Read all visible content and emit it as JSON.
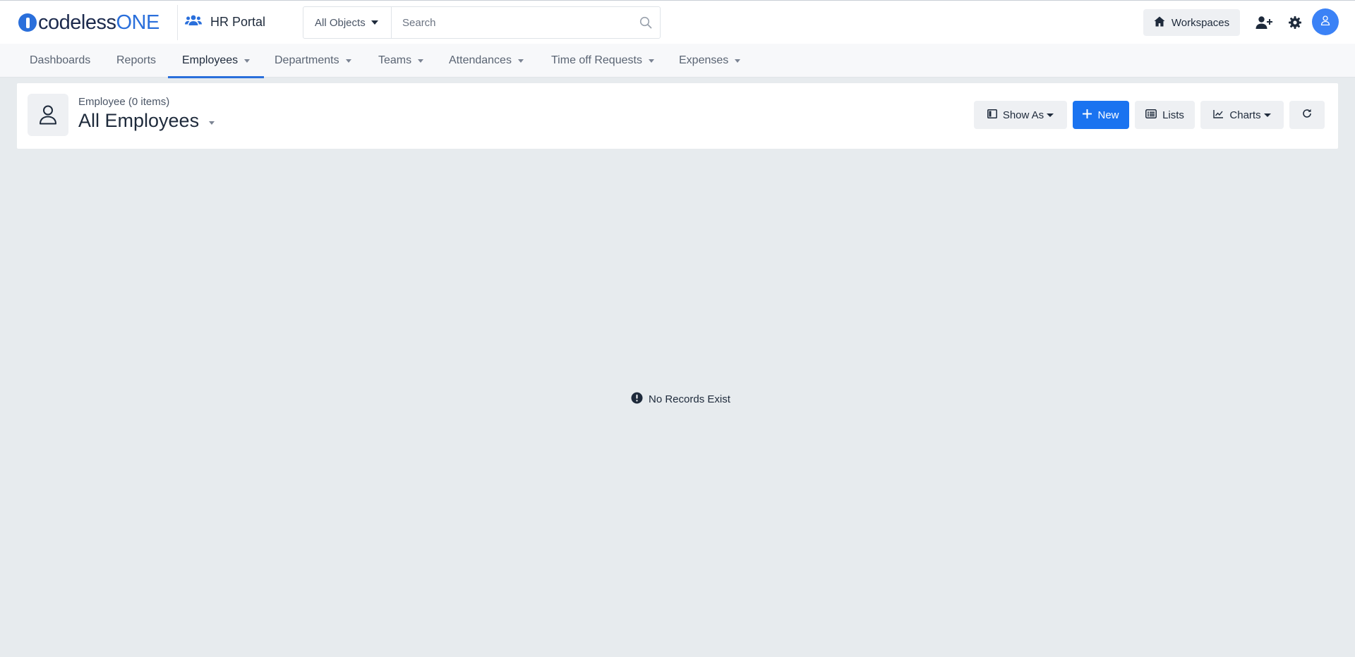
{
  "brand": {
    "logo_main": "codeless",
    "logo_accent": "ONE"
  },
  "app": {
    "name": "HR Portal"
  },
  "search": {
    "scope": "All Objects",
    "placeholder": "Search"
  },
  "header": {
    "workspaces_label": "Workspaces"
  },
  "nav": {
    "tabs": [
      {
        "label": "Dashboards",
        "has_dropdown": false,
        "active": false
      },
      {
        "label": "Reports",
        "has_dropdown": false,
        "active": false
      },
      {
        "label": "Employees",
        "has_dropdown": true,
        "active": true
      },
      {
        "label": "Departments",
        "has_dropdown": true,
        "active": false
      },
      {
        "label": "Teams",
        "has_dropdown": true,
        "active": false
      },
      {
        "label": "Attendances",
        "has_dropdown": true,
        "active": false
      },
      {
        "label": "Time off Requests",
        "has_dropdown": true,
        "active": false
      },
      {
        "label": "Expenses",
        "has_dropdown": true,
        "active": false
      }
    ]
  },
  "view": {
    "subtitle": "Employee (0 items)",
    "title": "All Employees",
    "actions": {
      "show_as": "Show As",
      "new": "New",
      "lists": "Lists",
      "charts": "Charts"
    }
  },
  "empty_state": {
    "message": "No Records Exist"
  },
  "icons": {
    "app": "users-icon",
    "search": "search-icon",
    "workspaces": "home-icon",
    "add_user": "user-plus-icon",
    "settings": "gear-icon",
    "avatar": "user-icon",
    "entity": "user-outline-icon",
    "show_as": "layout-icon",
    "new": "plus-icon",
    "lists": "list-icon",
    "charts": "chart-icon",
    "refresh": "refresh-icon",
    "empty": "exclamation-circle-icon"
  },
  "colors": {
    "accent": "#2a6fdb",
    "primary_button": "#1a73f0",
    "background": "#e7ebee",
    "text": "#1e2a3b"
  }
}
